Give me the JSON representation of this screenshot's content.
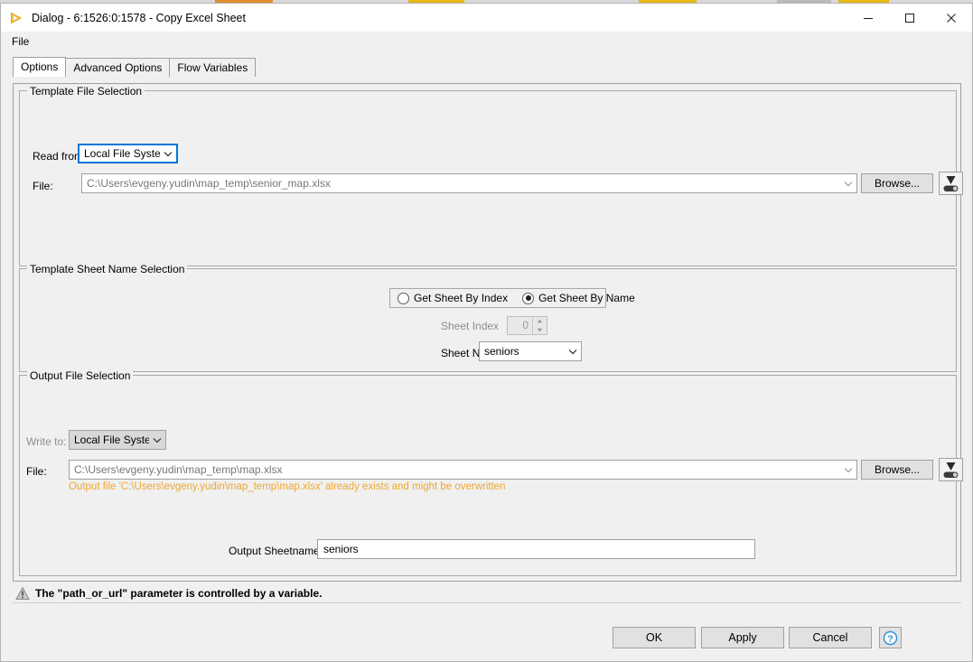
{
  "window": {
    "title": "Dialog - 6:1526:0:1578 - Copy Excel Sheet",
    "icon": "knime-triangle-icon",
    "controls": {
      "minimize": "minimize-icon",
      "maximize": "maximize-icon",
      "close": "close-icon"
    }
  },
  "menubar": {
    "items": [
      "File"
    ]
  },
  "tabs": [
    {
      "label": "Options",
      "selected": true
    },
    {
      "label": "Advanced Options",
      "selected": false
    },
    {
      "label": "Flow Variables",
      "selected": false
    }
  ],
  "template_file_selection": {
    "group_title": "Template File Selection",
    "read_from_label": "Read from:",
    "read_from_value": "Local File System",
    "file_label": "File:",
    "file_value": "C:\\Users\\evgeny.yudin\\map_temp\\senior_map.xlsx",
    "browse_label": "Browse...",
    "variable_button_icon": "flow-variable-icon"
  },
  "template_sheet_selection": {
    "group_title": "Template Sheet Name Selection",
    "radio_by_index": "Get Sheet By Index",
    "radio_by_name": "Get Sheet By Name",
    "selected_radio": "Get Sheet By Name",
    "sheet_index_label": "Sheet Index",
    "sheet_index_value": "0",
    "sheet_name_label": "Sheet Name",
    "sheet_name_value": "seniors"
  },
  "output_file_selection": {
    "group_title": "Output File Selection",
    "write_to_label": "Write to:",
    "write_to_value": "Local File System",
    "file_label": "File:",
    "file_value": "C:\\Users\\evgeny.yudin\\map_temp\\map.xlsx",
    "browse_label": "Browse...",
    "variable_button_icon": "flow-variable-icon",
    "warning_message": "Output file 'C:\\Users\\evgeny.yudin\\map_temp\\map.xlsx' already exists and might be overwritten",
    "warning_color": "#f0a830",
    "output_sheetname_label": "Output Sheetname",
    "output_sheetname_value": "seniors"
  },
  "statusbar": {
    "icon": "warning-triangle-icon",
    "message": "The \"path_or_url\" parameter is controlled by a variable."
  },
  "buttonbar": {
    "ok": "OK",
    "apply": "Apply",
    "cancel": "Cancel",
    "help_icon": "help-question-icon"
  },
  "colors": {
    "accent_focus": "#0078d7",
    "warning": "#f0a830",
    "window_bg": "#f0f0f0"
  }
}
